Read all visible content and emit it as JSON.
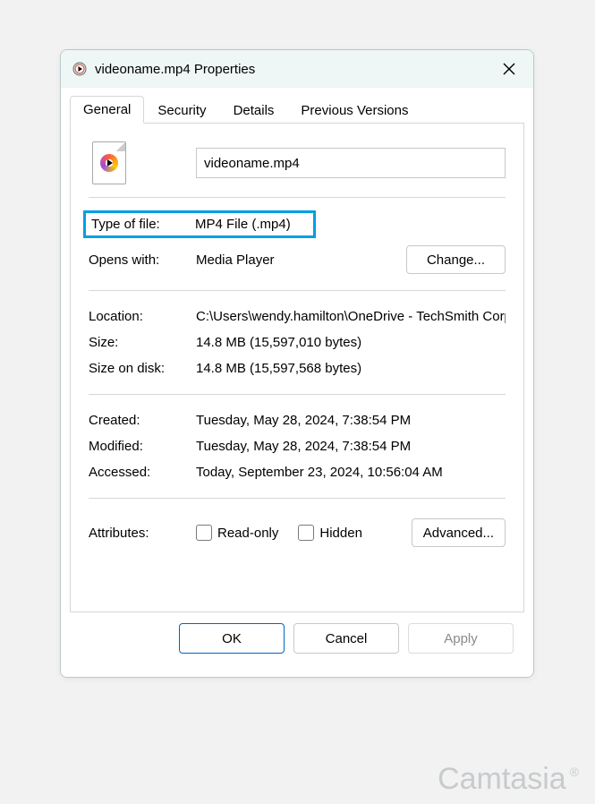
{
  "title": "videoname.mp4 Properties",
  "tabs": [
    "General",
    "Security",
    "Details",
    "Previous Versions"
  ],
  "filename": "videoname.mp4",
  "type_label": "Type of file:",
  "type_value": "MP4 File (.mp4)",
  "opens_label": "Opens with:",
  "opens_value": "Media Player",
  "change_label": "Change...",
  "location_label": "Location:",
  "location_value": "C:\\Users\\wendy.hamilton\\OneDrive - TechSmith Corp",
  "size_label": "Size:",
  "size_value": "14.8 MB (15,597,010 bytes)",
  "sizeondisk_label": "Size on disk:",
  "sizeondisk_value": "14.8 MB (15,597,568 bytes)",
  "created_label": "Created:",
  "created_value": "Tuesday, May 28, 2024, 7:38:54 PM",
  "modified_label": "Modified:",
  "modified_value": "Tuesday, May 28, 2024, 7:38:54 PM",
  "accessed_label": "Accessed:",
  "accessed_value": "Today, September 23, 2024, 10:56:04 AM",
  "attributes_label": "Attributes:",
  "readonly_label": "Read-only",
  "hidden_label": "Hidden",
  "advanced_label": "Advanced...",
  "ok_label": "OK",
  "cancel_label": "Cancel",
  "apply_label": "Apply",
  "watermark": "Camtasia"
}
